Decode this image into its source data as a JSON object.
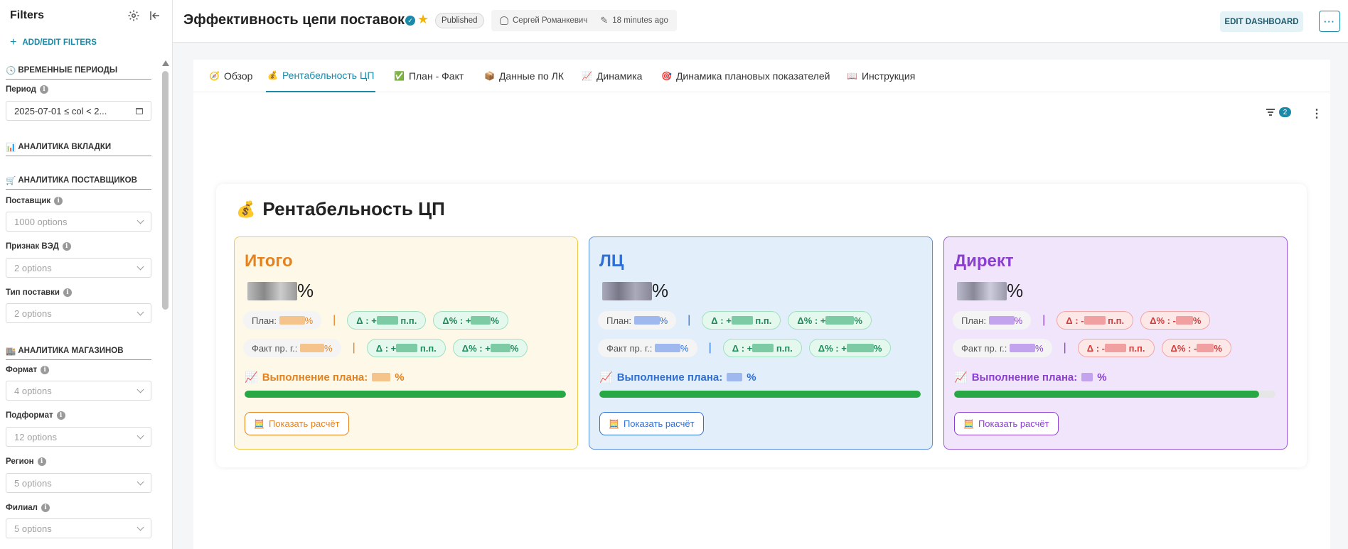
{
  "sidebar": {
    "title": "Filters",
    "add_filters": "ADD/EDIT FILTERS",
    "sections": {
      "time": "ВРЕМЕННЫЕ ПЕРИОДЫ",
      "tab_analytics": "АНАЛИТИКА ВКЛАДКИ",
      "supplier_analytics": "АНАЛИТИКА ПОСТАВЩИКОВ",
      "store_analytics": "АНАЛИТИКА МАГАЗИНОВ"
    },
    "fields": {
      "period": {
        "label": "Период",
        "value": "2025-07-01 ≤ col < 2..."
      },
      "supplier": {
        "label": "Поставщик",
        "placeholder": "1000 options"
      },
      "ved": {
        "label": "Признак ВЭД",
        "placeholder": "2 options"
      },
      "delivery": {
        "label": "Тип поставки",
        "placeholder": "2 options"
      },
      "format": {
        "label": "Формат",
        "placeholder": "4 options"
      },
      "subformat": {
        "label": "Подформат",
        "placeholder": "12 options"
      },
      "region": {
        "label": "Регион",
        "placeholder": "5 options"
      },
      "branch": {
        "label": "Филиал",
        "placeholder": "5 options"
      }
    }
  },
  "header": {
    "title": "Эффективность цепи поставок",
    "status": "Published",
    "owner": "Сергей Романкевич",
    "modified": "18 minutes ago",
    "edit_button": "EDIT DASHBOARD",
    "more_button": "···"
  },
  "tabs": [
    {
      "label": "Обзор",
      "icon": "🧭"
    },
    {
      "label": "Рентабельность ЦП",
      "icon": "💰"
    },
    {
      "label": "План - Факт",
      "icon": "✅"
    },
    {
      "label": "Данные по ЛК",
      "icon": "📦"
    },
    {
      "label": "Динамика",
      "icon": "📈"
    },
    {
      "label": "Динамика плановых показателей",
      "icon": "🎯"
    },
    {
      "label": "Инструкция",
      "icon": "📖"
    }
  ],
  "filter_count": "2",
  "panel": {
    "icon": "💰",
    "title": "Рентабельность ЦП",
    "cards": [
      {
        "name": "Итого",
        "color": "#e6821e",
        "percent_suffix": "%",
        "plan_label": "План:",
        "plan_suffix": "%",
        "delta_pp": "Δ : +",
        "delta_pp_unit": "п.п.",
        "delta_pct": "Δ% : +",
        "delta_pct_unit": "%",
        "fact_label": "Факт пр. г.:",
        "fact_suffix": "%",
        "fact_delta_pp": "Δ : +",
        "fact_delta_pp_unit": "п.п.",
        "fact_delta_pct": "Δ% : +",
        "fact_delta_pct_unit": "%",
        "perf_label": "Выполнение плана:",
        "perf_suffix": "%",
        "progress": 1.0,
        "button": "Показать расчёт"
      },
      {
        "name": "ЛЦ",
        "color": "#2f6fd6",
        "percent_suffix": "%",
        "plan_label": "План:",
        "plan_suffix": "%",
        "delta_pp": "Δ : +",
        "delta_pp_unit": "п.п.",
        "delta_pct": "Δ% : +",
        "delta_pct_unit": "%",
        "fact_label": "Факт пр. г.:",
        "fact_suffix": "%",
        "fact_delta_pp": "Δ : +",
        "fact_delta_pp_unit": "п.п.",
        "fact_delta_pct": "Δ% : +",
        "fact_delta_pct_unit": "%",
        "perf_label": "Выполнение плана:",
        "perf_suffix": "%",
        "progress": 1.0,
        "button": "Показать расчёт"
      },
      {
        "name": "Директ",
        "color": "#8a3fd1",
        "percent_suffix": "%",
        "plan_label": "План:",
        "plan_suffix": "%",
        "delta_pp": "Δ : -",
        "delta_pp_unit": "п.п.",
        "delta_pct": "Δ% : -",
        "delta_pct_unit": "%",
        "fact_label": "Факт пр. г.:",
        "fact_suffix": "%",
        "fact_delta_pp": "Δ : -",
        "fact_delta_pp_unit": "п.п.",
        "fact_delta_pct": "Δ% : -",
        "fact_delta_pct_unit": "%",
        "perf_label": "Выполнение плана:",
        "perf_suffix": "%",
        "progress": 0.95,
        "button": "Показать расчёт"
      }
    ]
  }
}
